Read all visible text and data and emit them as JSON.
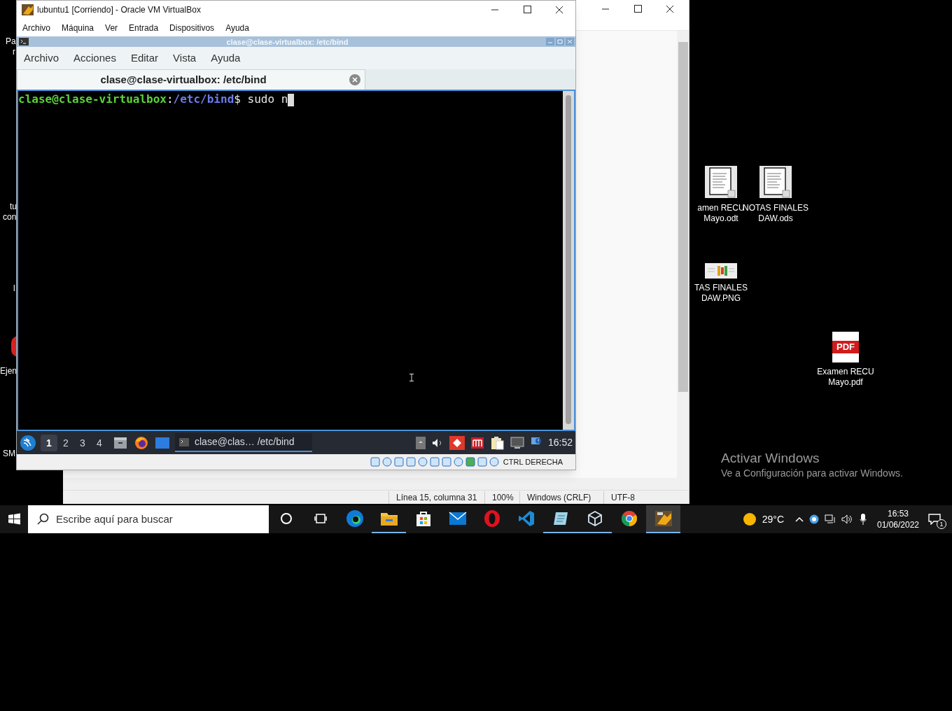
{
  "desktop_left_labels": [
    "Pa",
    "r",
    "tu",
    "con",
    "l",
    "Ejen",
    "SM"
  ],
  "notepad": {
    "status_bar": [
      "Línea 15, columna 31",
      "100%",
      "Windows (CRLF)",
      "UTF-8"
    ]
  },
  "virtualbox": {
    "title": "lubuntu1 [Corriendo] - Oracle VM VirtualBox",
    "menu": [
      "Archivo",
      "Máquina",
      "Ver",
      "Entrada",
      "Dispositivos",
      "Ayuda"
    ],
    "guest": {
      "window_title": "clase@clase-virtualbox: /etc/bind",
      "menu": [
        "Archivo",
        "Acciones",
        "Editar",
        "Vista",
        "Ayuda"
      ],
      "tab": {
        "label": "clase@clase-virtualbox: /etc/bind",
        "selected": true
      },
      "terminal": {
        "user_host": "clase@clase-virtualbox",
        "separator": ":",
        "path": "/etc/bind",
        "command": "$ sudo n"
      },
      "panel": {
        "workspaces": [
          {
            "label": "1",
            "selected": true
          },
          {
            "label": "2",
            "selected": false
          },
          {
            "label": "3",
            "selected": false
          },
          {
            "label": "4",
            "selected": false
          }
        ],
        "task": "clase@clas… /etc/bind",
        "clock": "16:52"
      }
    },
    "host_key": "CTRL DERECHA"
  },
  "desktop_icons": [
    {
      "kind": "document",
      "lines": [
        "amen RECU",
        "Mayo.odt"
      ]
    },
    {
      "kind": "sheet",
      "lines": [
        "NOTAS FINALES",
        "DAW.ods"
      ]
    },
    {
      "kind": "image",
      "lines": [
        "TAS FINALES",
        "DAW.PNG"
      ]
    },
    {
      "kind": "pdf",
      "badge": "PDF",
      "lines": [
        "Examen RECU",
        "Mayo.pdf"
      ]
    }
  ],
  "activation": {
    "title": "Activar Windows",
    "message": "Ve a Configuración para activar Windows."
  },
  "taskbar": {
    "search_placeholder": "Escribe aquí para buscar",
    "apps": [
      {
        "kind": "cortana",
        "running": false,
        "selected": false
      },
      {
        "kind": "taskview",
        "running": false,
        "selected": false
      },
      {
        "kind": "edge",
        "running": false,
        "selected": false
      },
      {
        "kind": "explorer",
        "running": true,
        "selected": false
      },
      {
        "kind": "store",
        "running": false,
        "selected": false
      },
      {
        "kind": "mail",
        "running": false,
        "selected": false
      },
      {
        "kind": "opera",
        "running": false,
        "selected": false
      },
      {
        "kind": "vscode",
        "running": false,
        "selected": false
      },
      {
        "kind": "notepad",
        "running": true,
        "selected": false
      },
      {
        "kind": "virtualbox",
        "running": true,
        "selected": false
      },
      {
        "kind": "chrome",
        "running": false,
        "selected": false
      },
      {
        "kind": "vm",
        "running": true,
        "selected": true
      }
    ],
    "weather": "29°C",
    "time": "16:53",
    "date": "01/06/2022",
    "notifications": "1"
  }
}
